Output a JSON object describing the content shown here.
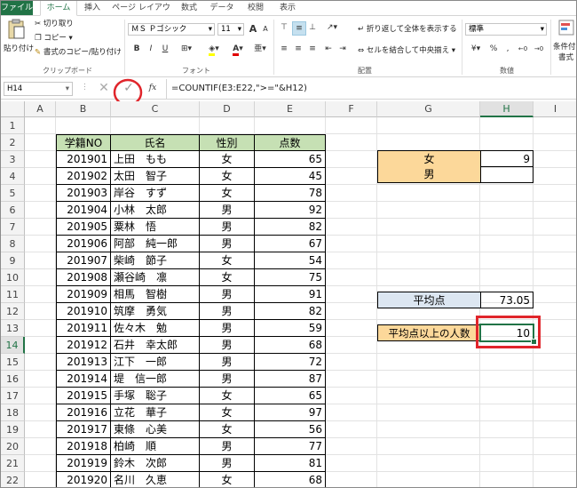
{
  "tabs": [
    "ファイル",
    "ホーム",
    "挿入",
    "ページ レイアウト",
    "数式",
    "データ",
    "校閲",
    "表示"
  ],
  "clipboard": {
    "paste": "貼り付け",
    "cut": "切り取り",
    "copy": "コピー",
    "format_painter": "書式のコピー/貼り付け",
    "group_label": "クリップボード"
  },
  "font": {
    "name": "ＭＳ Ｐゴシック",
    "size": "11",
    "bold": "B",
    "italic": "I",
    "underline": "U",
    "grow": "A",
    "shrink": "A",
    "group_label": "フォント"
  },
  "alignment": {
    "wrap": "折り返して全体を表示する",
    "merge": "セルを結合して中央揃え",
    "group_label": "配置"
  },
  "number": {
    "format": "標準",
    "group_label": "数値",
    "percent": "%",
    "comma": ","
  },
  "styles": {
    "conditional": "条件付き",
    "conditional2": "書式"
  },
  "formula_bar": {
    "name_box": "H14",
    "fx": "fx",
    "formula": "=COUNTIF(E3:E22,\">=\"&H12)"
  },
  "columns": [
    "A",
    "B",
    "C",
    "D",
    "E",
    "F",
    "G",
    "H",
    "I"
  ],
  "rows": [
    "1",
    "2",
    "3",
    "4",
    "5",
    "6",
    "7",
    "8",
    "9",
    "10",
    "11",
    "12",
    "13",
    "14",
    "15",
    "16",
    "17",
    "18",
    "19",
    "20",
    "21",
    "22",
    "23"
  ],
  "table": {
    "headers": [
      "学籍NO",
      "氏名",
      "性別",
      "点数"
    ],
    "rows": [
      [
        "201901",
        "上田　もも",
        "女",
        "65"
      ],
      [
        "201902",
        "太田　智子",
        "女",
        "45"
      ],
      [
        "201903",
        "岸谷　すず",
        "女",
        "78"
      ],
      [
        "201904",
        "小林　太郎",
        "男",
        "92"
      ],
      [
        "201905",
        "粟林　悟",
        "男",
        "82"
      ],
      [
        "201906",
        "阿部　純一郎",
        "男",
        "67"
      ],
      [
        "201907",
        "柴崎　節子",
        "女",
        "54"
      ],
      [
        "201908",
        "瀬谷崎　凛",
        "女",
        "75"
      ],
      [
        "201909",
        "相馬　智樹",
        "男",
        "91"
      ],
      [
        "201910",
        "筑摩　勇気",
        "男",
        "82"
      ],
      [
        "201911",
        "佐々木　勉",
        "男",
        "59"
      ],
      [
        "201912",
        "石井　幸太郎",
        "男",
        "68"
      ],
      [
        "201913",
        "江下　一郎",
        "男",
        "72"
      ],
      [
        "201914",
        "堤　信一郎",
        "男",
        "87"
      ],
      [
        "201915",
        "手塚　聡子",
        "女",
        "65"
      ],
      [
        "201916",
        "立花　華子",
        "女",
        "97"
      ],
      [
        "201917",
        "東條　心美",
        "女",
        "56"
      ],
      [
        "201918",
        "柏崎　順",
        "男",
        "77"
      ],
      [
        "201919",
        "鈴木　次郎",
        "男",
        "81"
      ],
      [
        "201920",
        "名川　久恵",
        "女",
        "68"
      ]
    ]
  },
  "summary": {
    "female_label": "女",
    "female_value": "9",
    "male_label": "男",
    "male_value": "",
    "avg_label": "平均点",
    "avg_value": "73.05",
    "above_label": "平均点以上の人数",
    "above_value": "10"
  },
  "colors": {
    "excel_green": "#217346",
    "header_fill": "#c6e0b4",
    "orange_fill": "#fcd89a",
    "blue_fill": "#dce6f1",
    "highlight_red": "#e0252b"
  }
}
